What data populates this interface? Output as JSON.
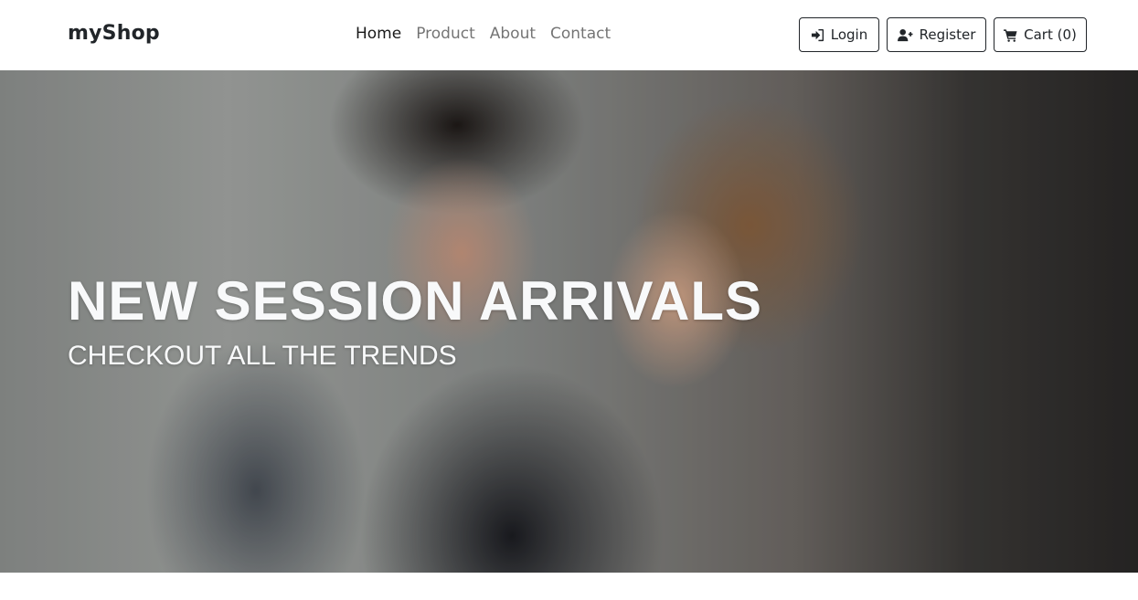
{
  "navbar": {
    "brand": "myShop",
    "links": [
      {
        "label": "Home",
        "active": true
      },
      {
        "label": "Product",
        "active": false
      },
      {
        "label": "About",
        "active": false
      },
      {
        "label": "Contact",
        "active": false
      }
    ],
    "buttons": {
      "login": {
        "label": "Login",
        "icon": "sign-in-icon"
      },
      "register": {
        "label": "Register",
        "icon": "user-plus-icon"
      },
      "cart": {
        "label": "Cart (0)",
        "icon": "cart-icon"
      }
    }
  },
  "hero": {
    "title": "NEW SESSION ARRIVALS",
    "subtitle": "CHECKOUT ALL THE TRENDS",
    "text_color": "#f8f9fa"
  }
}
